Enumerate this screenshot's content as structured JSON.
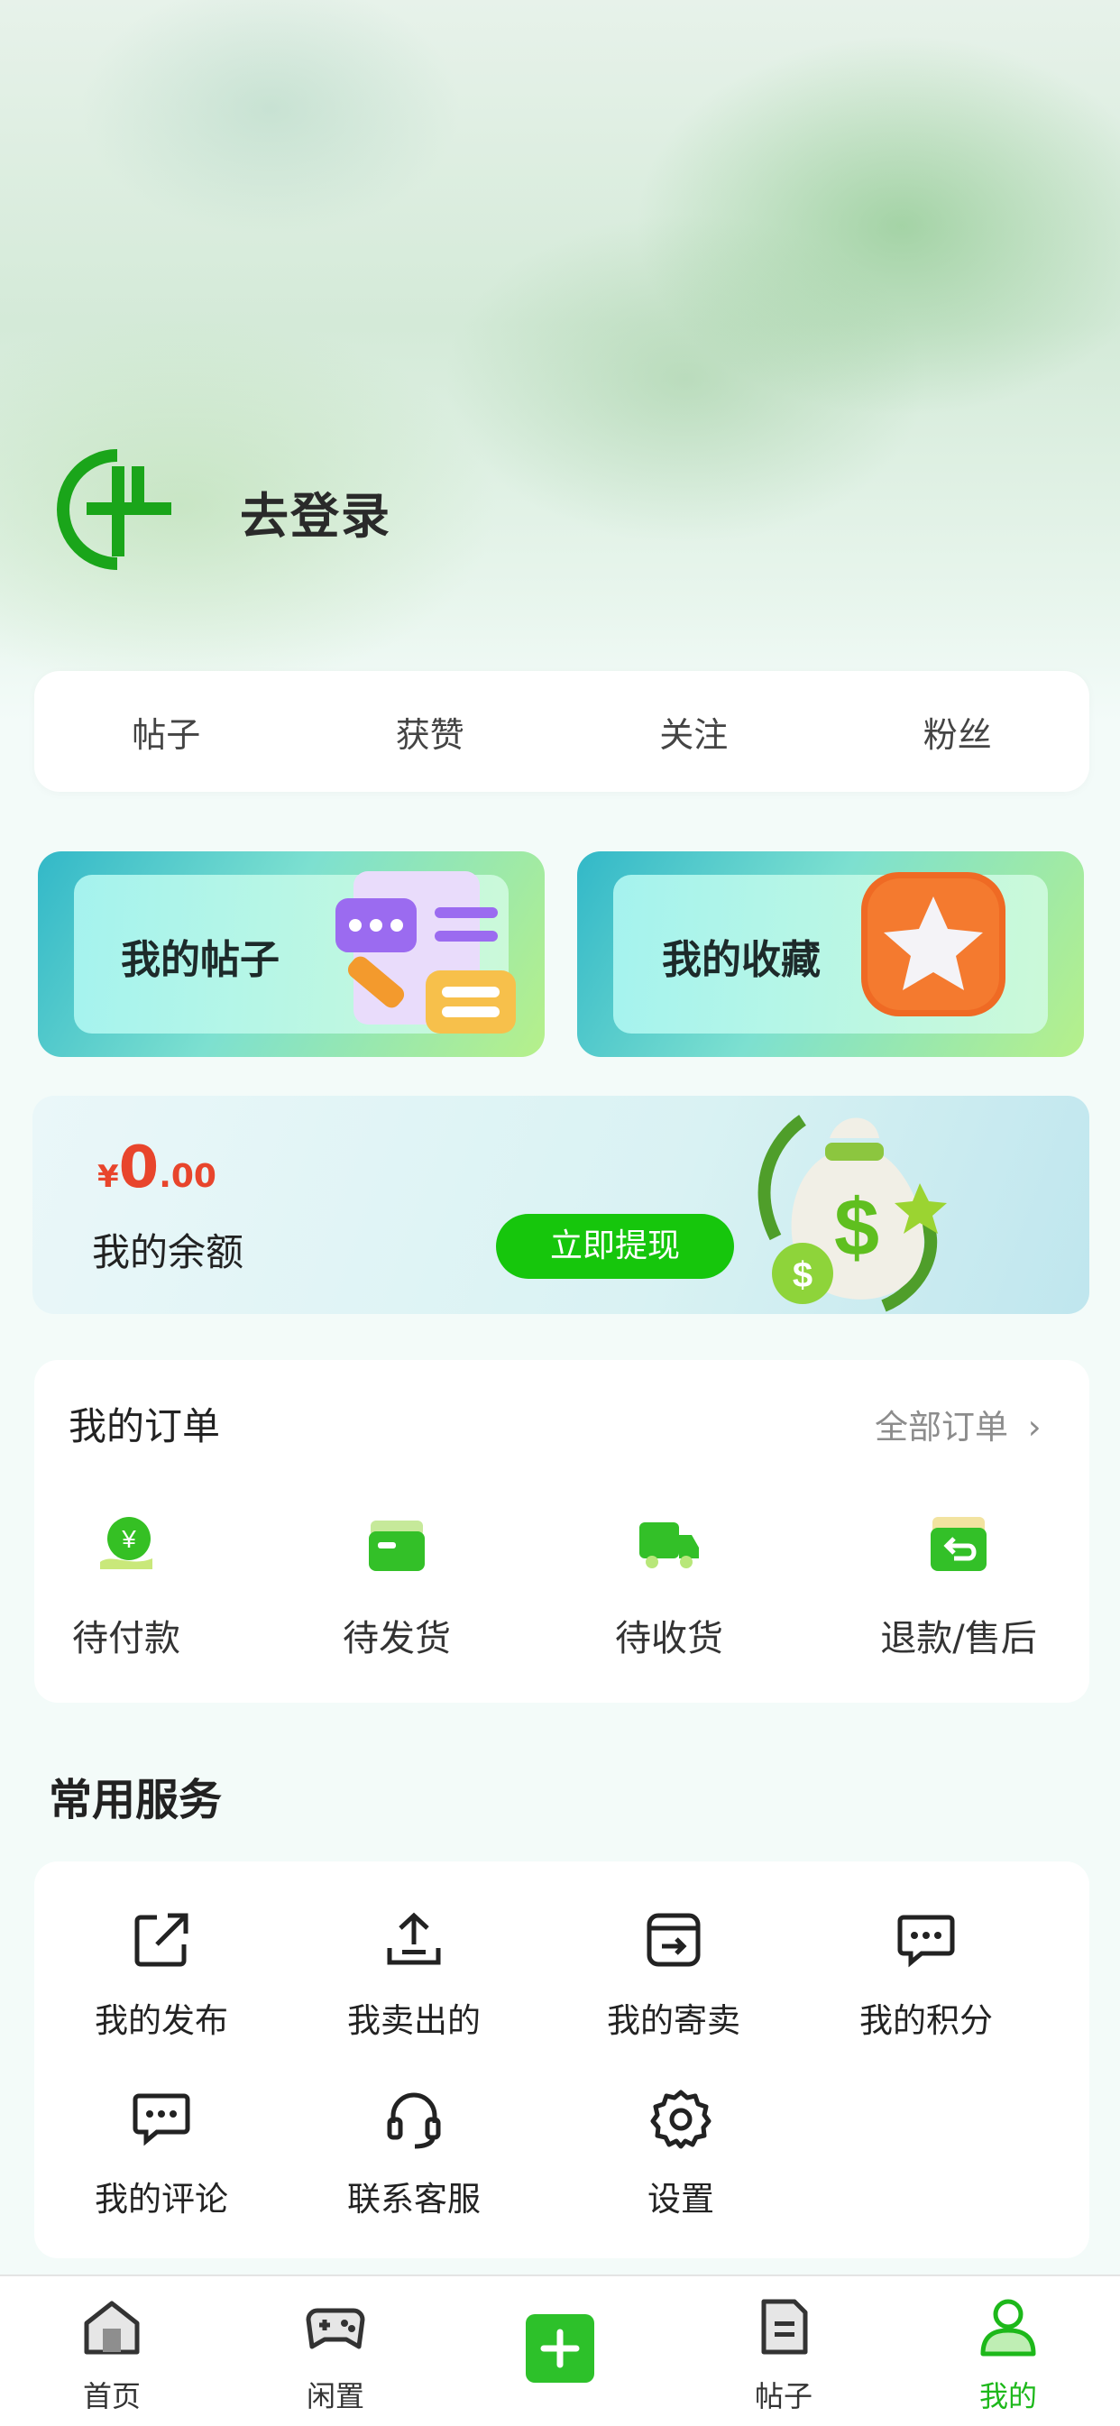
{
  "header": {
    "login_text": "去登录"
  },
  "stats": [
    "帖子",
    "获赞",
    "关注",
    "粉丝"
  ],
  "feature_cards": [
    {
      "label": "我的帖子",
      "icon": "posts-illustration-icon"
    },
    {
      "label": "我的收藏",
      "icon": "star-icon"
    }
  ],
  "balance": {
    "currency": "¥",
    "integer": "0",
    "decimal": ".00",
    "label": "我的余额",
    "withdraw_label": "立即提现"
  },
  "orders": {
    "title": "我的订单",
    "all_label": "全部订单",
    "items": [
      {
        "label": "待付款",
        "icon": "payment-icon"
      },
      {
        "label": "待发货",
        "icon": "box-icon"
      },
      {
        "label": "待收货",
        "icon": "truck-icon"
      },
      {
        "label": "退款/售后",
        "icon": "refund-icon"
      }
    ]
  },
  "services": {
    "title": "常用服务",
    "items": [
      {
        "label": "我的发布",
        "icon": "share-icon"
      },
      {
        "label": "我卖出的",
        "icon": "upload-icon"
      },
      {
        "label": "我的寄卖",
        "icon": "consign-icon"
      },
      {
        "label": "我的积分",
        "icon": "chat-icon"
      },
      {
        "label": "我的评论",
        "icon": "comment-icon"
      },
      {
        "label": "联系客服",
        "icon": "headset-icon"
      },
      {
        "label": "设置",
        "icon": "gear-icon"
      }
    ]
  },
  "tabbar": {
    "items": [
      {
        "label": "首页",
        "icon": "home-icon"
      },
      {
        "label": "闲置",
        "icon": "gamepad-icon"
      },
      {
        "label": "",
        "icon": "plus-icon"
      },
      {
        "label": "帖子",
        "icon": "document-icon"
      },
      {
        "label": "我的",
        "icon": "user-icon"
      }
    ],
    "active_index": 4
  },
  "colors": {
    "accent": "#16c60c",
    "price": "#e8452c"
  }
}
